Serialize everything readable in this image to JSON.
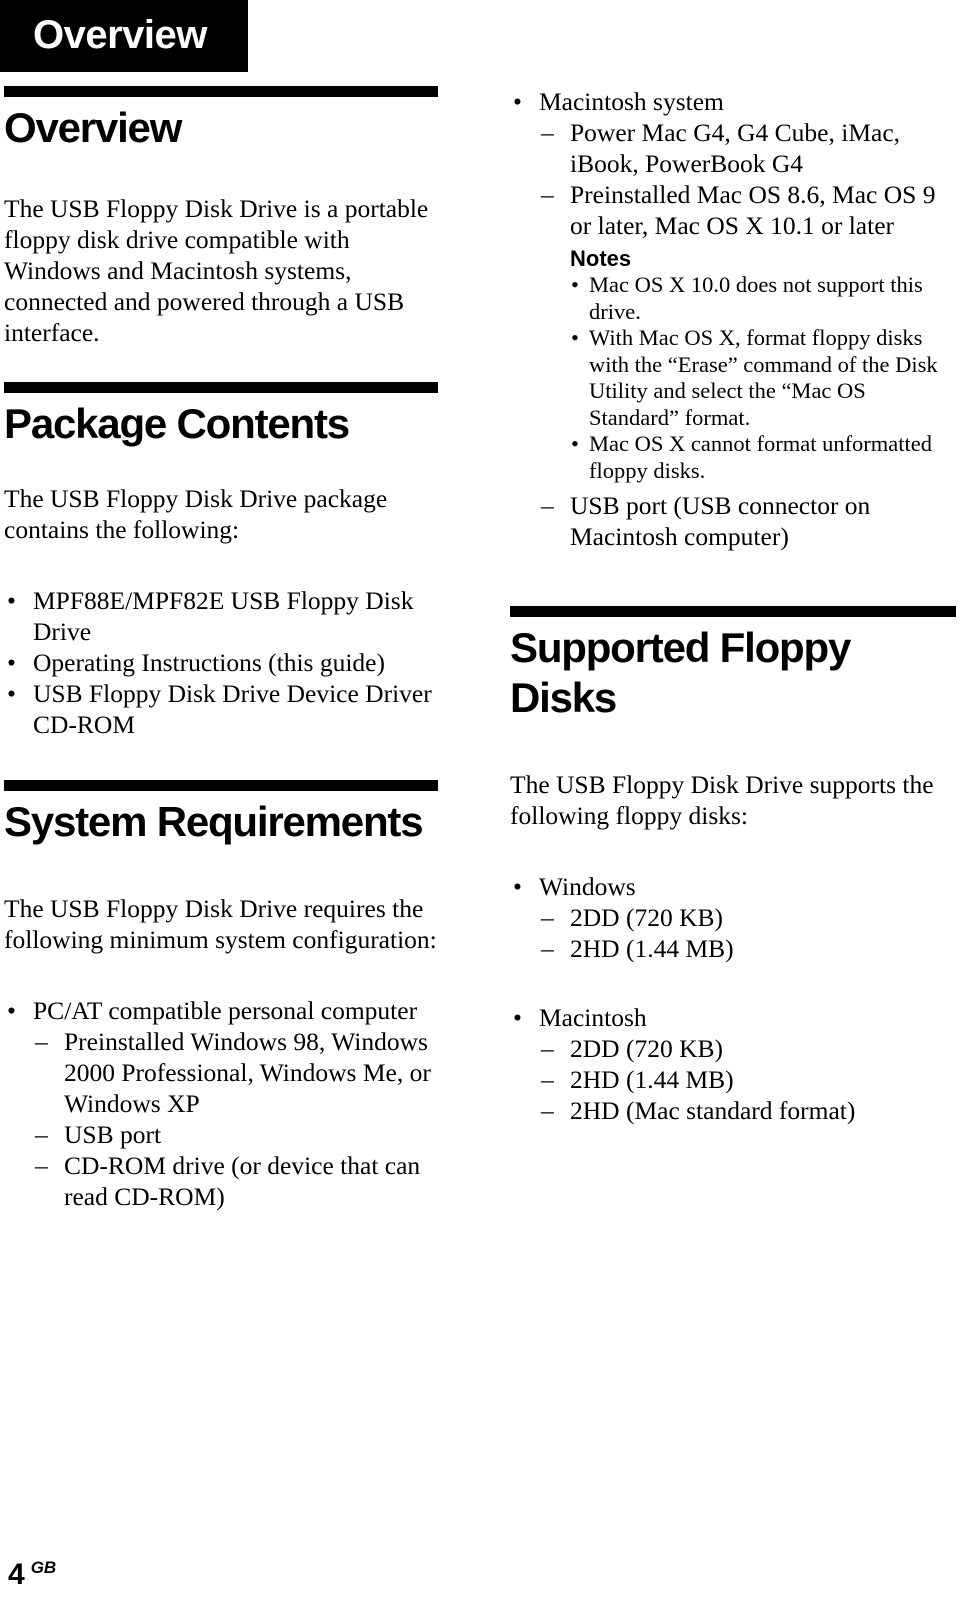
{
  "chapter_tab": {
    "label": "Overview"
  },
  "left_column": {
    "sections": [
      {
        "id": "overview",
        "title": "Overview",
        "paragraph": "The USB Floppy Disk Drive is a portable floppy disk drive compatible with Windows and Macintosh systems, connected and powered through a USB interface."
      },
      {
        "id": "package-contents",
        "title": "Package Contents",
        "paragraph": "The USB Floppy Disk Drive package contains the following:",
        "bullets": [
          "MPF88E/MPF82E USB Floppy Disk Drive",
          "Operating Instructions (this guide)",
          "USB Floppy Disk Drive Device Driver CD-ROM"
        ]
      },
      {
        "id": "system-requirements",
        "title": "System Requirements",
        "paragraph": "The USB Floppy Disk Drive requires the following minimum system configuration:",
        "bullet_group": {
          "label": "PC/AT compatible personal computer",
          "sub_items": [
            "Preinstalled Windows 98, Windows 2000 Professional, Windows Me, or Windows XP",
            "USB port",
            "CD-ROM drive (or device that can read CD-ROM)"
          ]
        }
      }
    ]
  },
  "right_column": {
    "mac_requirements": {
      "label": "Macintosh system",
      "sub_items_before_notes": [
        "Power Mac G4, G4 Cube, iMac, iBook, PowerBook G4",
        "Preinstalled Mac OS 8.6, Mac OS 9 or later, Mac OS X 10.1 or later"
      ],
      "notes_heading": "Notes",
      "notes": [
        "Mac OS X 10.0 does not support this drive.",
        "With Mac OS X, format floppy disks with the “Erase” command of the Disk Utility and select the “Mac OS Standard” format.",
        "Mac OS X cannot format unformatted floppy disks."
      ],
      "sub_items_after_notes": [
        "USB port (USB connector on Macintosh computer)"
      ]
    },
    "supported_floppy_disks": {
      "title": "Supported Floppy Disks",
      "paragraph": "The USB Floppy Disk Drive supports the following floppy disks:",
      "groups": [
        {
          "label": "Windows",
          "items": [
            "2DD (720 KB)",
            "2HD (1.44 MB)"
          ]
        },
        {
          "label": "Macintosh",
          "items": [
            "2DD (720 KB)",
            "2HD (1.44 MB)",
            "2HD (Mac standard format)"
          ]
        }
      ]
    }
  },
  "footer": {
    "page_number": "4",
    "language_code": "GB"
  },
  "markers": {
    "bullet": "•",
    "dash": "–"
  }
}
